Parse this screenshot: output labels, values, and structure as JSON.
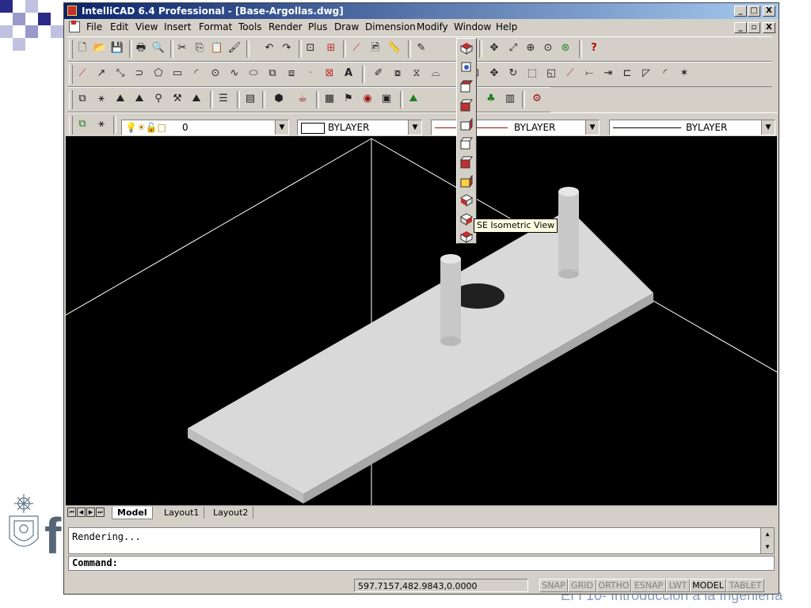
{
  "window": {
    "title": "IntelliCAD 6.4 Professional  - [Base-Argollas.dwg]",
    "caption_buttons": [
      "_",
      "□",
      "X"
    ],
    "doc_buttons": [
      "_",
      "▫",
      "X"
    ]
  },
  "menu": [
    "File",
    "Edit",
    "View",
    "Insert",
    "Format",
    "Tools",
    "Render",
    "Plus",
    "Draw",
    "Dimension",
    "Modify",
    "Window",
    "Help"
  ],
  "properties": {
    "layer": "0",
    "color": "BYLAYER",
    "linetype": "BYLAYER",
    "lineweight": "BYLAYER"
  },
  "flyout": {
    "tooltip": "SE Isometric View"
  },
  "layout_tabs": [
    "Model",
    "Layout1",
    "Layout2"
  ],
  "command": {
    "history": "Rendering...",
    "prompt": "Command:"
  },
  "status": {
    "coordinates": "597.7157,482.9843,0.0000",
    "toggles": [
      "SNAP",
      "GRID",
      "ORTHO",
      "ESNAP",
      "LWT",
      "MODEL",
      "TABLET"
    ],
    "active": "MODEL"
  },
  "slide": {
    "brand_fragment": "f",
    "footer": "EI I 10- Introducción a la Ingeniería"
  },
  "colors": {
    "title_start": "#0a246a",
    "title_end": "#a6caf0",
    "viewport_bg": "#000000",
    "model_fill": "#d9d9d9"
  }
}
